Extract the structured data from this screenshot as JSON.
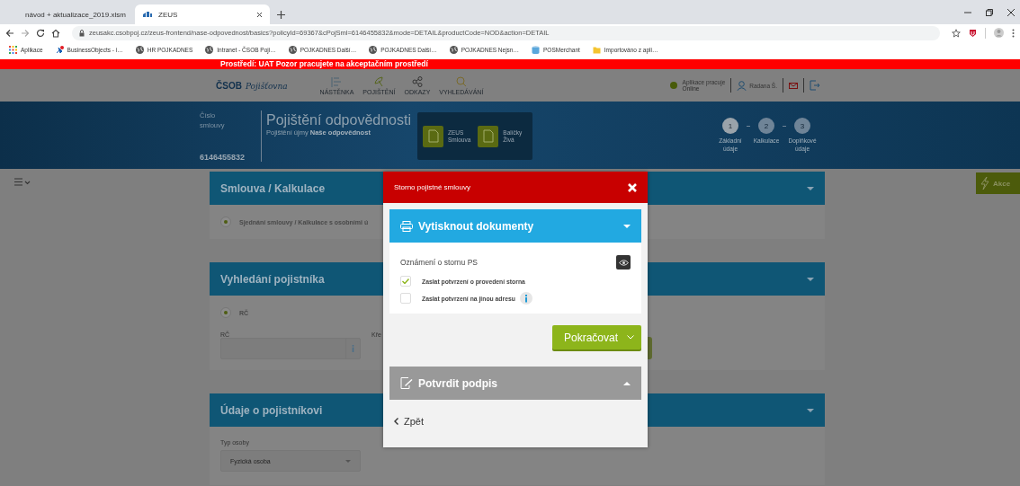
{
  "browser": {
    "tabs": [
      {
        "title": "návod + aktualizace_2019.xlsm",
        "kind": "sheet",
        "selected": false
      },
      {
        "title": "ZEUS",
        "kind": "zeus",
        "selected": true
      }
    ],
    "url": "zeusakc.csobpoj.cz/zeus-frontend/nase-odpovednost/basics?policyId=69367&cPojSml=6146455832&mode=DETAIL&productCode=NOD&action=DETAIL",
    "bookmarks": [
      {
        "label": "Aplikace",
        "kind": "apps"
      },
      {
        "label": "BusinessObjects - i…",
        "kind": "bo"
      },
      {
        "label": "HR  POJKADNES",
        "kind": "globe"
      },
      {
        "label": "Intranet - ČSOB Poji…",
        "kind": "globe"
      },
      {
        "label": "POJKADNES  Další…",
        "kind": "globe"
      },
      {
        "label": "POJKADNES  Další…",
        "kind": "globe"
      },
      {
        "label": "POJKADNES  Nejsn…",
        "kind": "globe"
      },
      {
        "label": "POSMerchant",
        "kind": "db"
      },
      {
        "label": "Importováno z apli…",
        "kind": "folder"
      }
    ]
  },
  "banner": "Prostředí: UAT Pozor pracujete na akceptačním prostředí",
  "header": {
    "logo": "ČSOB",
    "logo_sub": "Pojišťovna",
    "nav": [
      {
        "label": "NÁSTĚNKA",
        "kind": "board"
      },
      {
        "label": "POJIŠTĚNÍ",
        "kind": "umbrella"
      },
      {
        "label": "ODKAZY",
        "kind": "share"
      },
      {
        "label": "VYHLEDÁVÁNÍ",
        "kind": "search"
      }
    ],
    "status": {
      "label": "Aplikace pracuje",
      "sub": "Online"
    },
    "user": "Radana Š."
  },
  "hero": {
    "contract_label": "Číslo smlouvy",
    "contract_number": "6146455832",
    "title": "Pojištění odpovědnosti",
    "subtitle": "Pojištění újmy **Naše odpovědnost**",
    "docs": [
      {
        "line1": "ZEUS",
        "line2": "Smlouva"
      },
      {
        "line1": "Balíčky",
        "line2": "Živá"
      }
    ],
    "steps": [
      {
        "number": "1",
        "label": "Základní údaje",
        "selected": true
      },
      {
        "number": "2",
        "label": "Kalkulace",
        "selected": false
      },
      {
        "number": "3",
        "label": "Doplňkové údaje",
        "selected": false
      }
    ]
  },
  "actions_button": "Akce",
  "panels": [
    {
      "title": "Smlouva / Kalkulace",
      "kind": "radio",
      "radio": "Sjednání smlouvy / Kalkulace s osobními ú",
      "radio_selected": true
    },
    {
      "title": "Vyhledání pojistníka",
      "kind": "search",
      "radio": "RČ",
      "radio_selected": true,
      "field_label": "RČ",
      "field_label_2": "Kře"
    },
    {
      "title": "Údaje o pojistníkovi",
      "kind": "select",
      "field_label": "Typ osoby",
      "value": "Fyzická osoba"
    }
  ],
  "modal": {
    "title": "Storno pojistné smlouvy",
    "sections": [
      {
        "title": "Vytisknout dokumenty",
        "kind": "print",
        "expanded": true
      },
      {
        "title": "Potvrdit podpis",
        "kind": "sign",
        "expanded": false
      }
    ],
    "document": "Oznámení o stornu PS",
    "options": [
      {
        "label": "Zaslat potvrzení o provedení storna",
        "checked": true,
        "info": false
      },
      {
        "label": "Zaslat potvrzení na jinou adresu",
        "checked": false,
        "info": true
      }
    ],
    "continue": "Pokračovat",
    "back": "Zpět"
  }
}
